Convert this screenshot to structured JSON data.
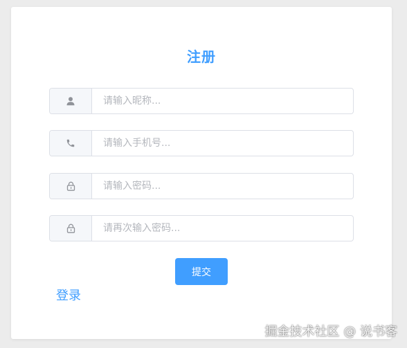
{
  "form": {
    "title": "注册",
    "fields": [
      {
        "placeholder": "请输入昵称...",
        "icon": "user-icon"
      },
      {
        "placeholder": "请输入手机号...",
        "icon": "phone-icon"
      },
      {
        "placeholder": "请输入密码...",
        "icon": "lock-icon"
      },
      {
        "placeholder": "请再次输入密码...",
        "icon": "lock-icon"
      }
    ],
    "submit_label": "提交",
    "login_link": "登录"
  },
  "watermark": "掘金技术社区 @ 说书客",
  "colors": {
    "primary": "#409eff",
    "border": "#dcdfe6",
    "prepend_bg": "#f5f7fa",
    "icon": "#909399"
  }
}
